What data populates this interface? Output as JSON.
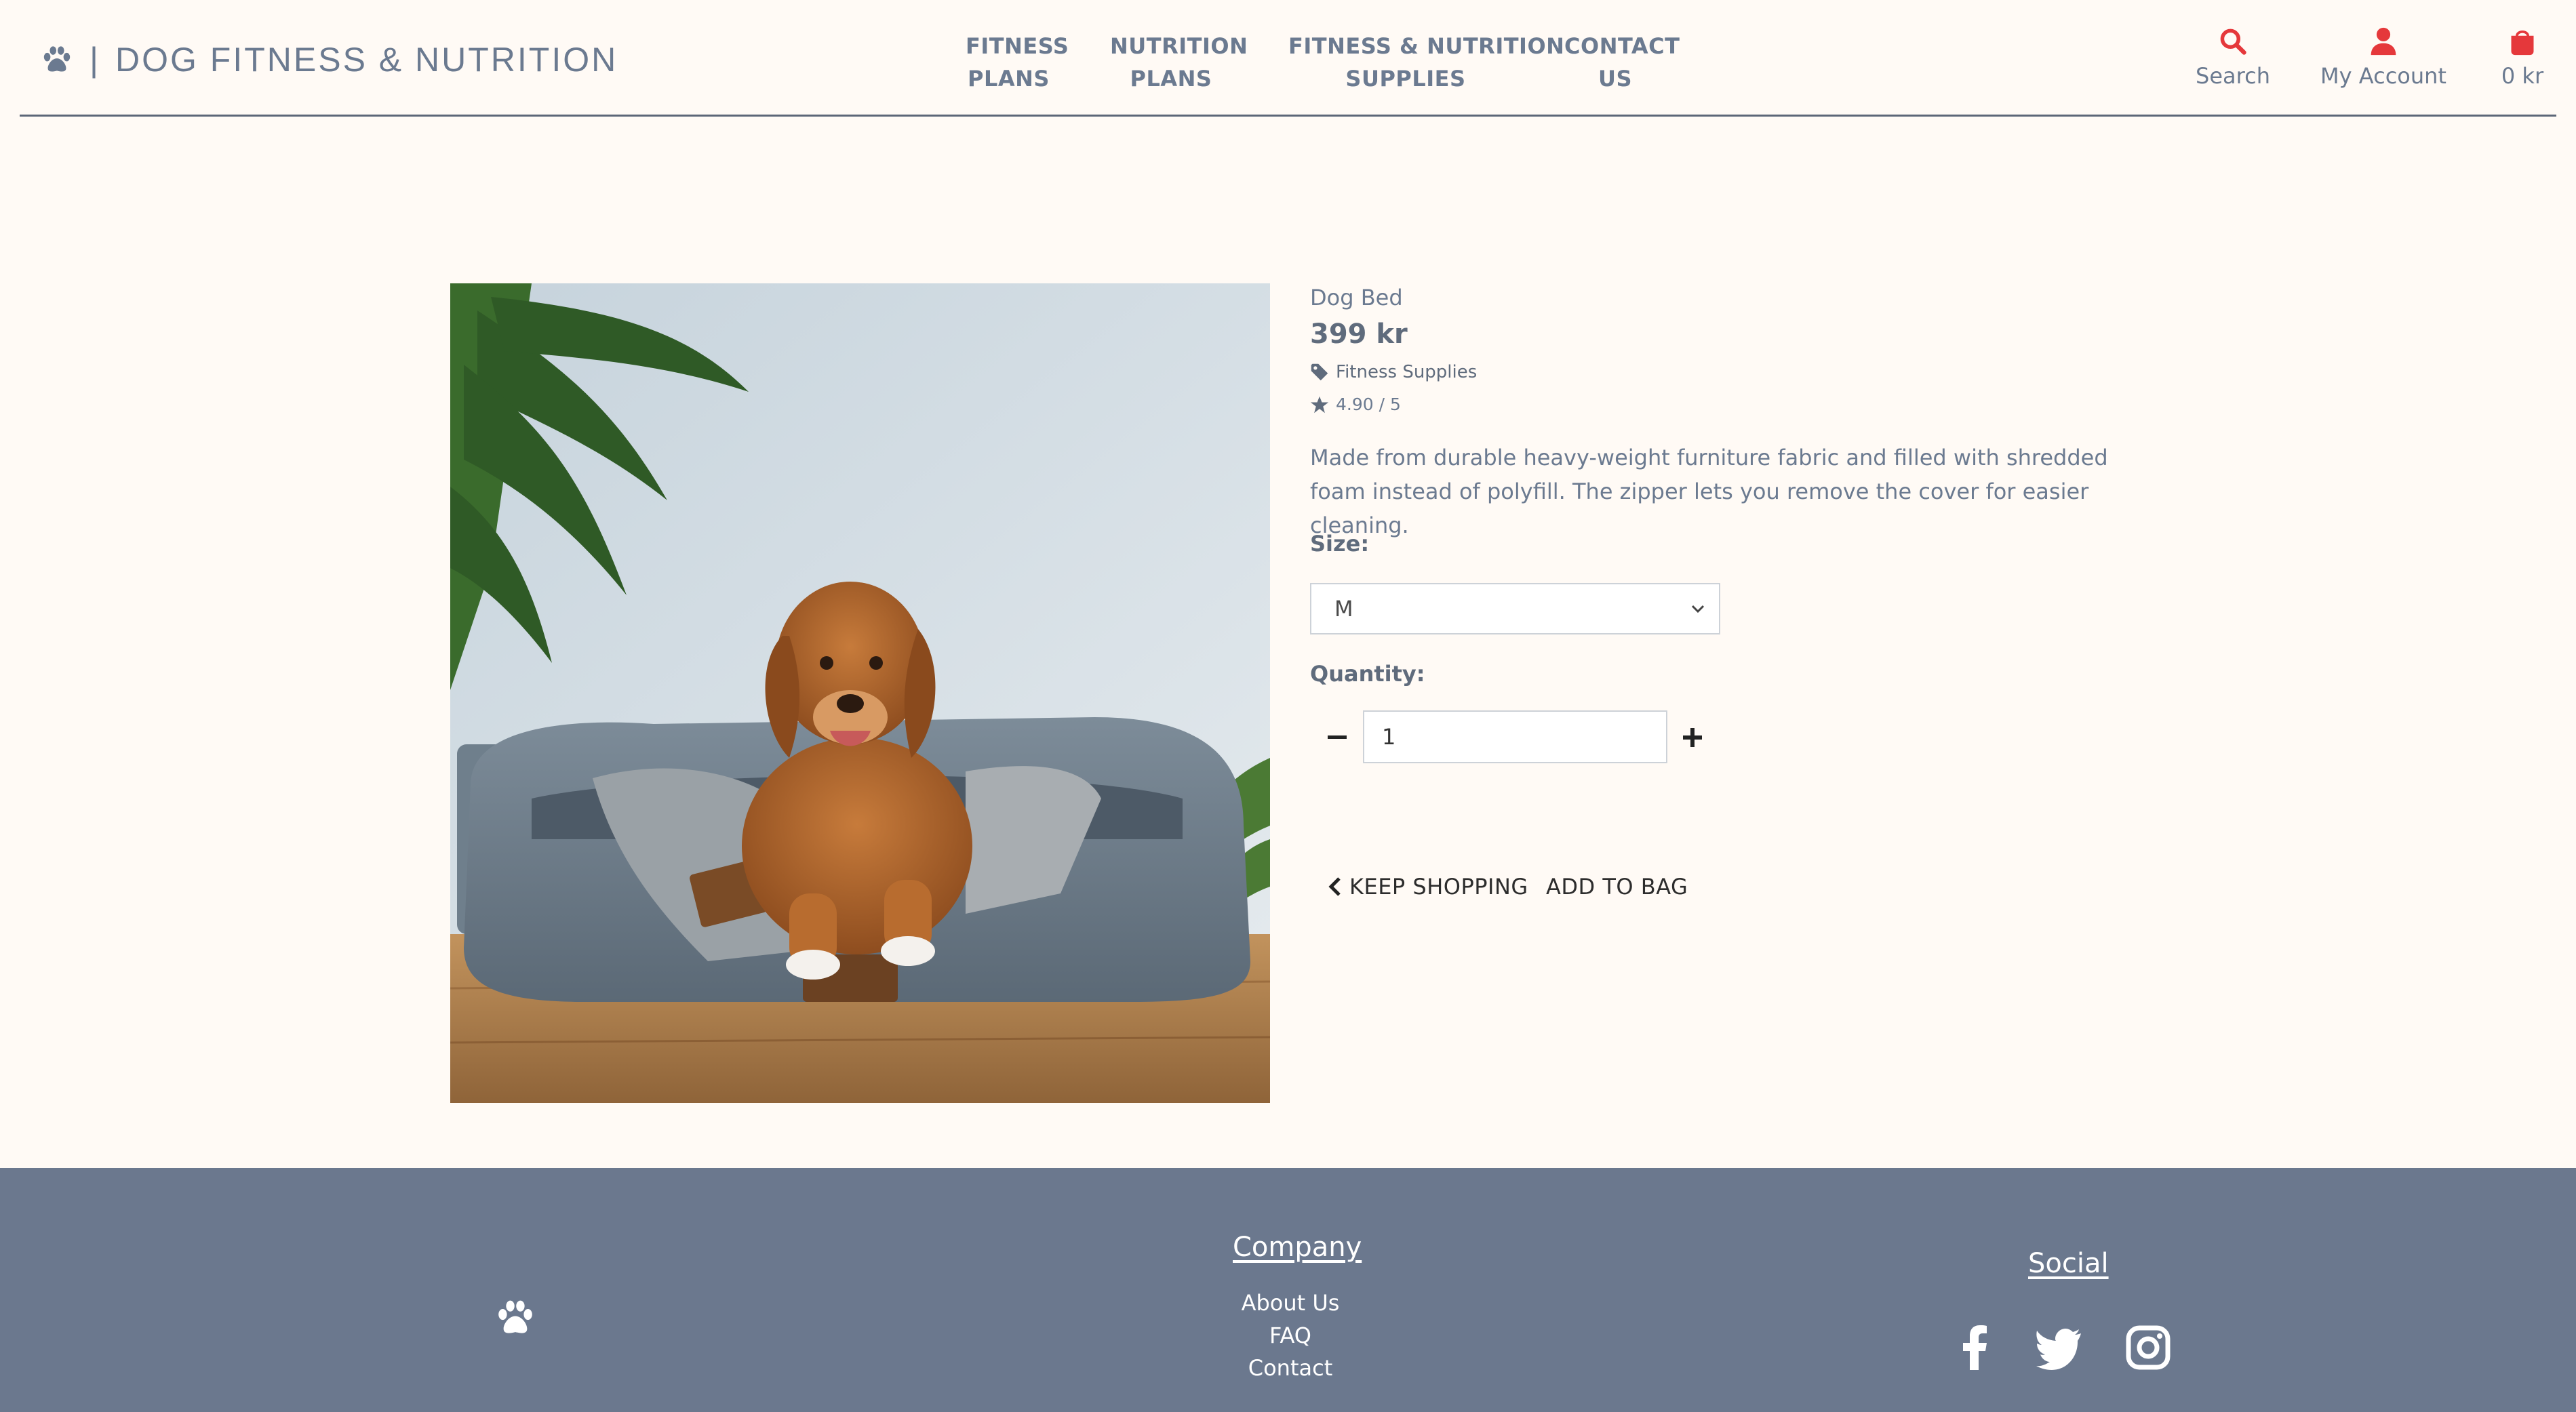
{
  "brand": {
    "divider": "|",
    "name": "DOG FITNESS & NUTRITION",
    "logo_icon": "paw-icon"
  },
  "nav": [
    {
      "line1": "FITNESS",
      "line2": "PLANS"
    },
    {
      "line1": "NUTRITION",
      "line2": "PLANS"
    },
    {
      "line1": "FITNESS & NUTRITION",
      "line2": "SUPPLIES"
    },
    {
      "line1": "CONTACT",
      "line2": "US"
    }
  ],
  "utility": {
    "search": {
      "label": "Search",
      "icon": "search-icon"
    },
    "account": {
      "label": "My Account",
      "icon": "user-icon"
    },
    "bag": {
      "label": "0 kr",
      "icon": "shopping-bag-icon"
    }
  },
  "product": {
    "name": "Dog Bed",
    "price": "399 kr",
    "category": "Fitness Supplies",
    "rating": "4.90 / 5",
    "description": "Made from durable heavy-weight furniture fabric and filled with shredded foam instead of polyfill. The zipper lets you remove the cover for easier cleaning.",
    "size_label": "Size:",
    "size_value": "M",
    "quantity_label": "Quantity:",
    "quantity_value": "1",
    "keep_shopping": "KEEP SHOPPING",
    "add_to_bag": "ADD TO BAG"
  },
  "footer": {
    "company_heading": "Company",
    "company_links": [
      "About Us",
      "FAQ",
      "Contact"
    ],
    "social_heading": "Social",
    "social_icons": [
      "facebook-icon",
      "twitter-icon",
      "instagram-icon"
    ]
  },
  "colors": {
    "background": "#fffaf5",
    "text": "#6b7a90",
    "accent": "#e5383b",
    "footer": "#6b788e"
  }
}
